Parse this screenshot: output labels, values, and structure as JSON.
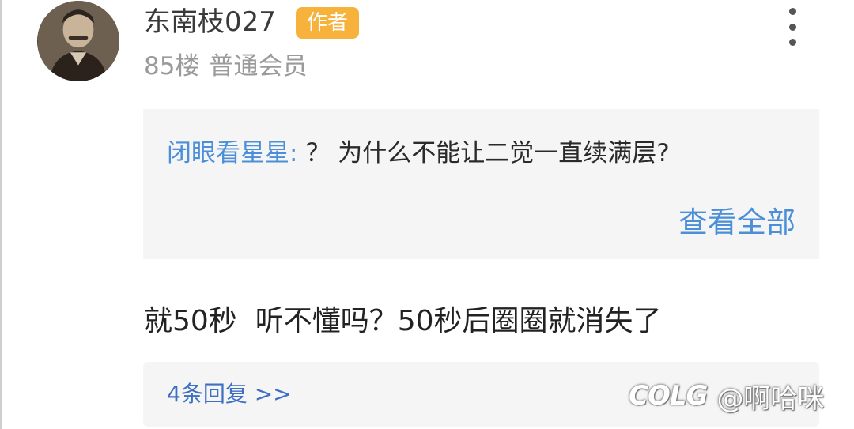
{
  "post": {
    "username": "东南枝027",
    "badge": "作者",
    "floor": "85楼",
    "member_level": "普通会员"
  },
  "quote": {
    "author": "闭眼看星星:",
    "text": "？ 为什么不能让二觉一直续满层?",
    "view_all": "查看全部"
  },
  "reply": {
    "text": "就50秒  听不懂吗？50秒后圈圈就消失了"
  },
  "replies": {
    "label": "4条回复 >>"
  },
  "watermark": {
    "logo": "COLG",
    "handle": "@啊哈咪"
  },
  "icons": {
    "more": "more-vertical-icon",
    "avatar": "user-avatar"
  },
  "colors": {
    "accent_blue": "#4a8fd8",
    "badge_orange": "#f7b23b",
    "panel_gray": "#f5f5f5"
  }
}
